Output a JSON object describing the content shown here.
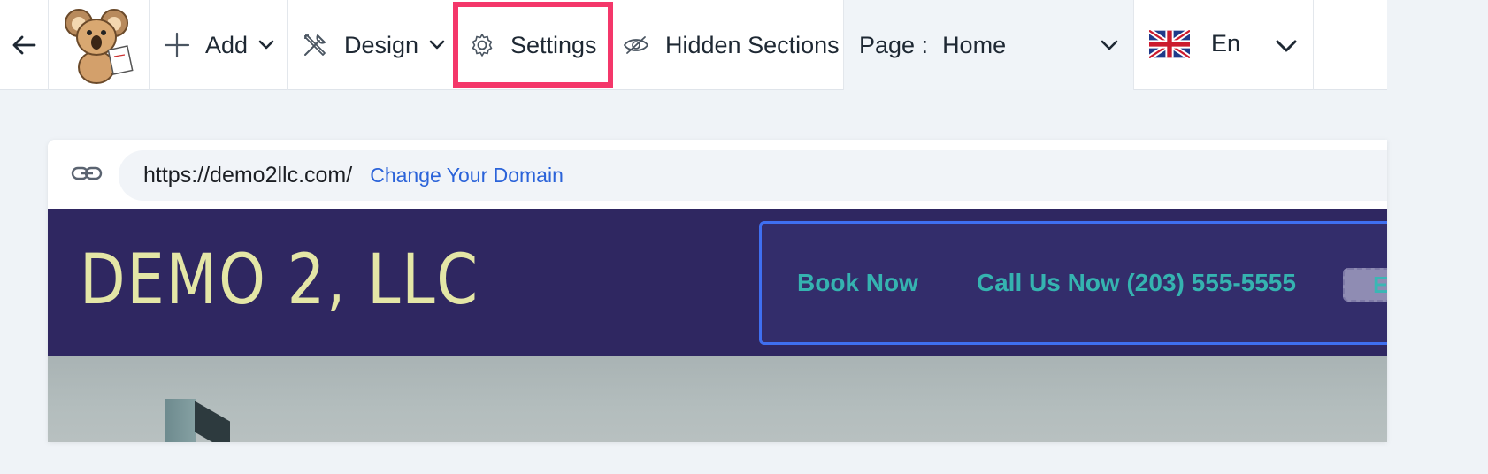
{
  "toolbar": {
    "add_label": "Add",
    "design_label": "Design",
    "settings_label": "Settings",
    "hidden_label": "Hidden Sections",
    "page_prefix": "Page :",
    "page_value": "Home",
    "lang_label": "En",
    "icons": {
      "back": "arrow-left-icon",
      "logo": "koala-mascot-logo",
      "add": "plus-icon",
      "design": "tools-icon",
      "settings": "gear-icon",
      "hidden": "eye-slash-icon",
      "lang_flag": "uk-flag-icon",
      "chevron": "chevron-down-icon"
    },
    "highlight_color": "#f4376a"
  },
  "preview": {
    "url": "https://demo2llc.com/",
    "change_domain": "Change Your Domain",
    "site_name": "DEMO 2, LLC",
    "nav": {
      "book": "Book Now",
      "call": "Call Us Now (203) 555-5555",
      "extra": "E"
    },
    "colors": {
      "header_bg": "#2f2761",
      "logo_text": "#e4e6a6",
      "nav_text": "#35b3b0",
      "nav_border": "#3f6ff0",
      "link": "#2b63d9"
    }
  }
}
